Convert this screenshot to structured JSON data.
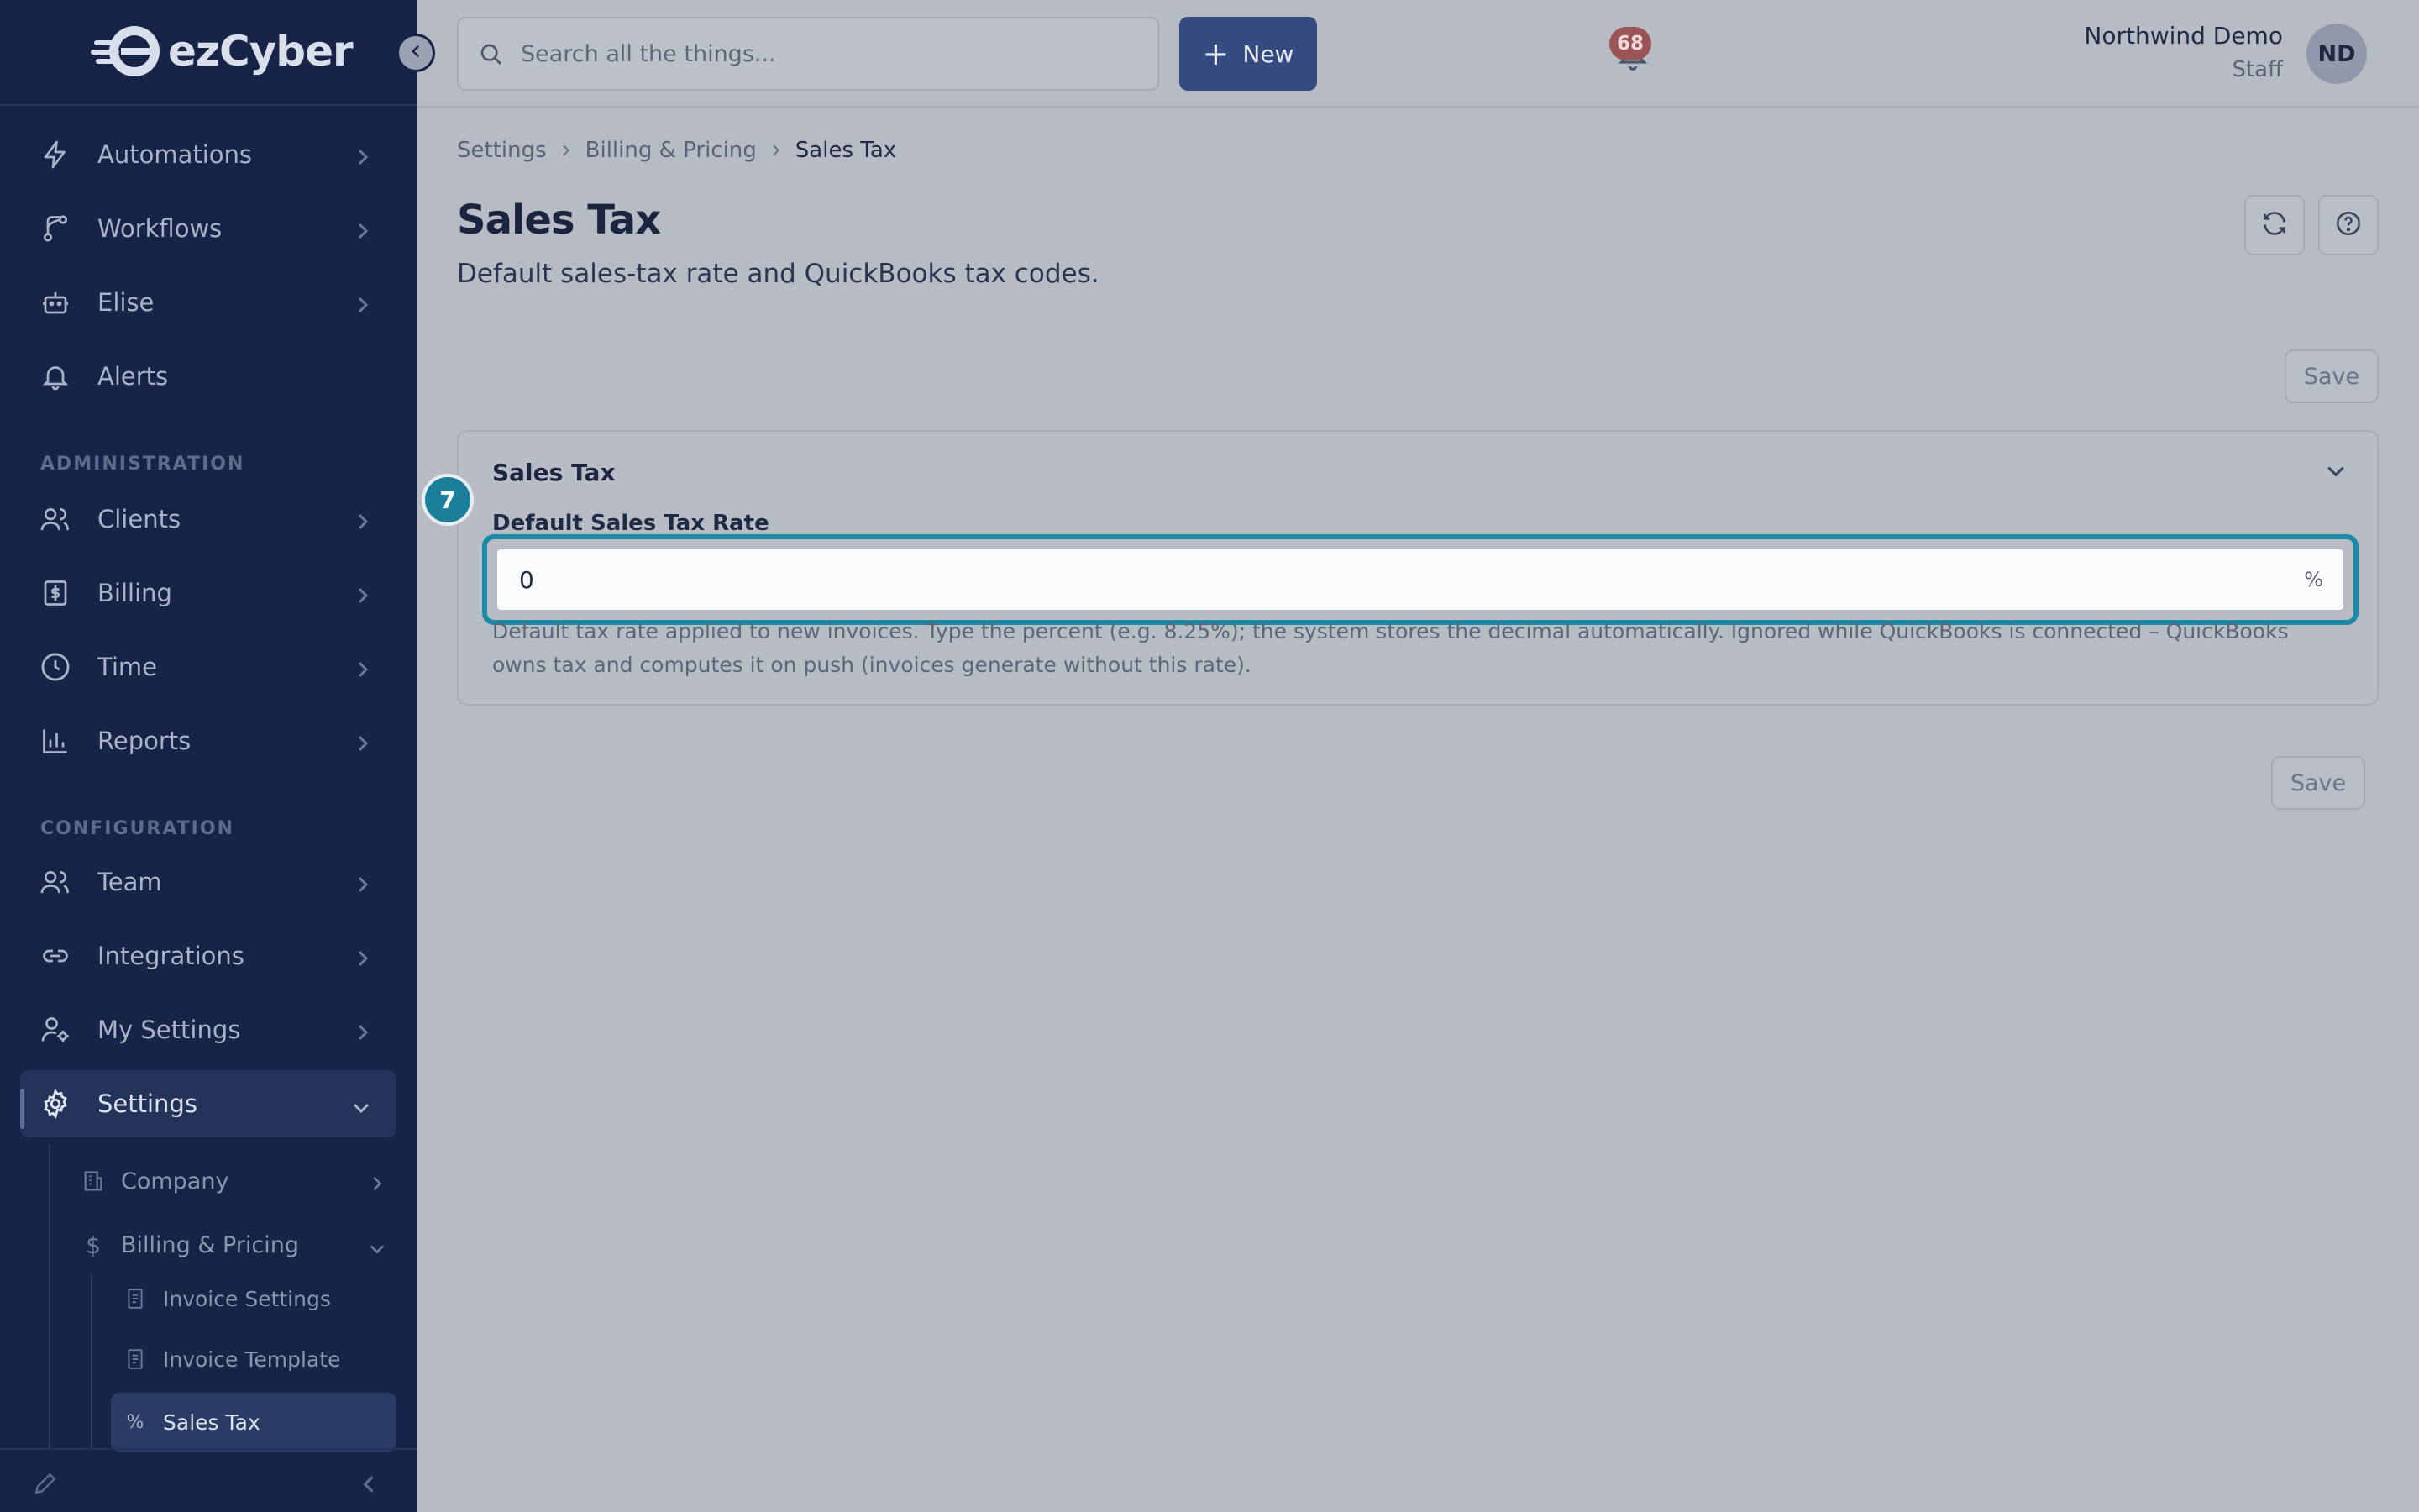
{
  "app": {
    "brand": "ezCyber"
  },
  "sidebar": {
    "items": [
      {
        "label": "Automations",
        "icon": "bolt-icon"
      },
      {
        "label": "Workflows",
        "icon": "workflow-icon"
      },
      {
        "label": "Elise",
        "icon": "bot-icon"
      },
      {
        "label": "Alerts",
        "icon": "bell-icon"
      }
    ],
    "admin_section": "ADMINISTRATION",
    "admin_items": [
      {
        "label": "Clients",
        "icon": "users-icon"
      },
      {
        "label": "Billing",
        "icon": "receipt-dollar-icon"
      },
      {
        "label": "Time",
        "icon": "clock-icon"
      },
      {
        "label": "Reports",
        "icon": "bar-chart-icon"
      }
    ],
    "config_section": "CONFIGURATION",
    "config_items": [
      {
        "label": "Team",
        "icon": "users-icon"
      },
      {
        "label": "Integrations",
        "icon": "link-icon"
      },
      {
        "label": "My Settings",
        "icon": "user-cog-icon"
      },
      {
        "label": "Settings",
        "icon": "gear-icon",
        "active": true
      }
    ],
    "settings_children": [
      {
        "label": "Company",
        "icon": "building-icon"
      },
      {
        "label": "Billing & Pricing",
        "icon": "dollar-icon",
        "expanded": true
      }
    ],
    "billing_children": [
      {
        "label": "Invoice Settings",
        "icon": "file-icon"
      },
      {
        "label": "Invoice Template",
        "icon": "file-icon"
      },
      {
        "label": "Sales Tax",
        "icon": "percent-icon",
        "active": true
      }
    ]
  },
  "topbar": {
    "search_placeholder": "Search all the things...",
    "new_label": "New",
    "notification_count": "68",
    "user_name": "Northwind Demo",
    "user_role": "Staff",
    "avatar_initials": "ND"
  },
  "breadcrumb": [
    "Settings",
    "Billing & Pricing",
    "Sales Tax"
  ],
  "page": {
    "title": "Sales Tax",
    "subtitle": "Default sales-tax rate and QuickBooks tax codes.",
    "save_label": "Save"
  },
  "card": {
    "title": "Sales Tax",
    "field_label": "Default Sales Tax Rate",
    "field_value": "0",
    "field_suffix": "%",
    "help_text": "Default tax rate applied to new invoices. Type the percent (e.g. 8.25%); the system stores the decimal automatically. Ignored while QuickBooks is connected – QuickBooks owns tax and computes it on push (invoices generate without this rate)."
  },
  "step_marker": "7",
  "colors": {
    "sidebar_bg": "#172447",
    "primary": "#334b80",
    "focus_ring": "#1a8aa6",
    "badge": "#9a5456"
  }
}
